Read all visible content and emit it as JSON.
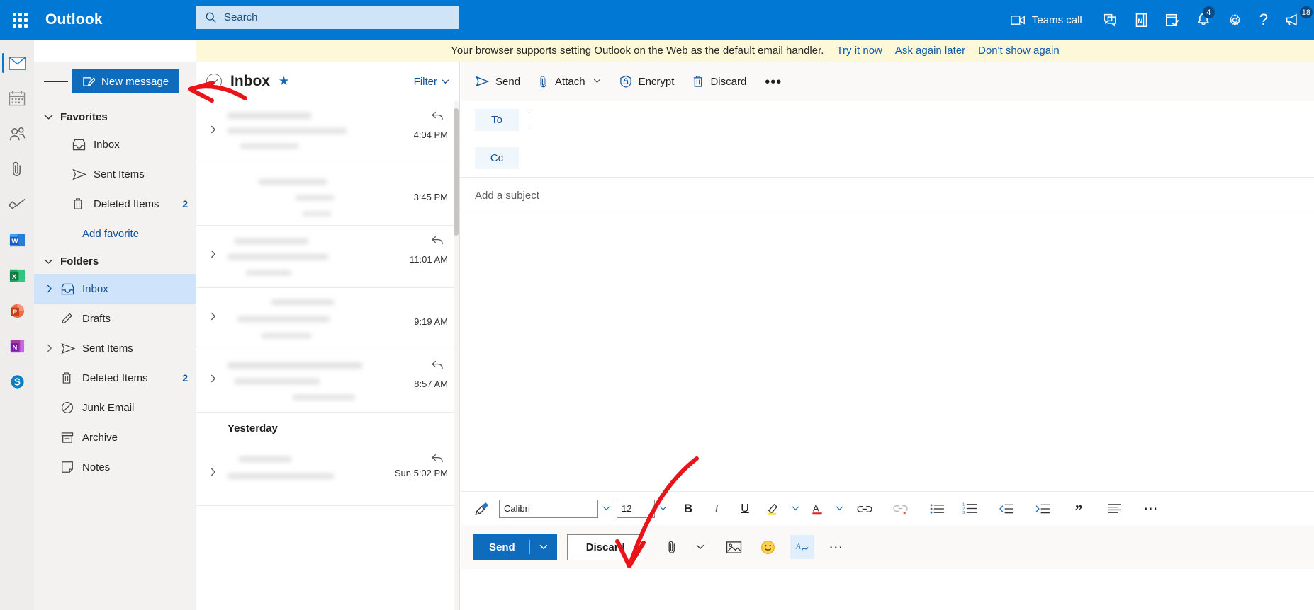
{
  "topbar": {
    "waffle_label": "App launcher",
    "brand": "Outlook",
    "search_placeholder": "Search",
    "search_value": "",
    "teams_call_label": "Teams call",
    "items": [
      {
        "name": "chat-icon",
        "badge": ""
      },
      {
        "name": "onenote-icon",
        "badge": ""
      },
      {
        "name": "tasks-icon",
        "badge": ""
      },
      {
        "name": "notifications-bell-icon",
        "badge": "4"
      },
      {
        "name": "settings-gear-icon",
        "badge": ""
      },
      {
        "name": "help-question-icon",
        "badge": ""
      },
      {
        "name": "feedback-megaphone-icon",
        "badge": "18"
      }
    ],
    "bell_badge": "4",
    "megaphone_badge": "18",
    "help_glyph": "?"
  },
  "banner": {
    "message": "Your browser supports setting Outlook on the Web as the default email handler.",
    "links": [
      "Try it now",
      "Ask again later",
      "Don't show again"
    ]
  },
  "app_rail": [
    {
      "label": "Mail",
      "icon": "mail-icon",
      "selected": true
    },
    {
      "label": "Calendar",
      "icon": "calendar-icon",
      "selected": false
    },
    {
      "label": "People",
      "icon": "people-icon",
      "selected": false
    },
    {
      "label": "Files",
      "icon": "paperclip-files-icon",
      "selected": false
    },
    {
      "label": "To Do",
      "icon": "todo-check-icon",
      "selected": false
    },
    {
      "label": "Word",
      "icon": "word-icon",
      "selected": false
    },
    {
      "label": "Excel",
      "icon": "excel-icon",
      "selected": false
    },
    {
      "label": "PowerPoint",
      "icon": "powerpoint-icon",
      "selected": false
    },
    {
      "label": "OneNote",
      "icon": "onenote-icon",
      "selected": false
    },
    {
      "label": "Skype",
      "icon": "skype-icon",
      "selected": false
    }
  ],
  "navpane": {
    "new_message_label": "New message",
    "favorites": {
      "title": "Favorites",
      "items": [
        {
          "label": "Inbox",
          "icon": "inbox-icon",
          "count": "",
          "twisty": false
        },
        {
          "label": "Sent Items",
          "icon": "sent-icon",
          "count": "",
          "twisty": false
        },
        {
          "label": "Deleted Items",
          "icon": "trash-icon",
          "count": "2",
          "twisty": false
        }
      ],
      "add_favorite_label": "Add favorite"
    },
    "folders": {
      "title": "Folders",
      "items": [
        {
          "label": "Inbox",
          "icon": "inbox-icon",
          "count": "",
          "twisty": true,
          "selected": true
        },
        {
          "label": "Drafts",
          "icon": "pencil-icon",
          "count": "",
          "twisty": false,
          "selected": false
        },
        {
          "label": "Sent Items",
          "icon": "sent-icon",
          "count": "",
          "twisty": true,
          "selected": false
        },
        {
          "label": "Deleted Items",
          "icon": "trash-icon",
          "count": "2",
          "twisty": false,
          "selected": false
        },
        {
          "label": "Junk Email",
          "icon": "block-icon",
          "count": "",
          "twisty": false,
          "selected": false
        },
        {
          "label": "Archive",
          "icon": "archive-icon",
          "count": "",
          "twisty": false,
          "selected": false
        },
        {
          "label": "Notes",
          "icon": "notes-icon",
          "count": "",
          "twisty": false,
          "selected": false
        }
      ]
    }
  },
  "msglist": {
    "title": "Inbox",
    "filter_label": "Filter",
    "rows": [
      {
        "time": "4:04 PM",
        "has_reply": true,
        "has_chevron": true
      },
      {
        "time": "3:45 PM",
        "has_reply": false,
        "has_chevron": false
      },
      {
        "time": "11:01 AM",
        "has_reply": true,
        "has_chevron": true
      },
      {
        "time": "9:19 AM",
        "has_reply": false,
        "has_chevron": true
      },
      {
        "time": "8:57 AM",
        "has_reply": true,
        "has_chevron": true
      }
    ],
    "day_separator": "Yesterday",
    "rows_after": [
      {
        "time": "Sun 5:02 PM",
        "has_reply": true,
        "has_chevron": true
      }
    ]
  },
  "compose": {
    "commands": [
      {
        "label": "Send",
        "icon": "send-arrow-icon",
        "caret": false
      },
      {
        "label": "Attach",
        "icon": "paperclip-icon",
        "caret": true
      },
      {
        "label": "Encrypt",
        "icon": "lock-shield-icon",
        "caret": false
      },
      {
        "label": "Discard",
        "icon": "trash-icon",
        "caret": false
      },
      {
        "label": "•••",
        "icon": "more-options-icon",
        "caret": false
      }
    ],
    "to_label": "To",
    "to_value": "",
    "cc_label": "Cc",
    "cc_value": "",
    "subject_placeholder": "Add a subject",
    "subject_value": "",
    "body_value": "",
    "format": {
      "font_name": "Calibri",
      "font_size": "12",
      "bold_glyph": "B",
      "italic_glyph": "I",
      "underline_glyph": "U",
      "buttons": [
        "format-painter-icon",
        "font-name-input",
        "font-name-dropdown-icon",
        "font-size-input",
        "font-size-dropdown-icon",
        "bold-button",
        "italic-button",
        "underline-button",
        "highlight-color-button",
        "highlight-dropdown-icon",
        "font-color-button",
        "font-color-dropdown-icon",
        "insert-link-button",
        "remove-link-button",
        "bulleted-list-button",
        "numbered-list-button",
        "decrease-indent-button",
        "increase-indent-button",
        "quote-button",
        "align-button",
        "more-formatting-button"
      ]
    },
    "actions": {
      "send_label": "Send",
      "discard_label": "Discard",
      "attach_icon": "paperclip-icon",
      "attach_caret_icon": "chevron-down-icon",
      "image_icon": "insert-picture-icon",
      "emoji_icon": "emoji-icon",
      "signature_icon": "signature-icon",
      "more_icon": "more-options-icon"
    }
  },
  "annotations": [
    {
      "name": "arrow-to-new-message",
      "color": "#e8141a"
    },
    {
      "name": "arrow-to-send-button",
      "color": "#e8141a"
    }
  ],
  "colors": {
    "brand_blue": "#0078d4",
    "button_blue": "#0f6cbd",
    "banner_yellow": "#fdf9d8",
    "selection_blue": "#cfe4fa",
    "annotation_red": "#e8141a"
  }
}
